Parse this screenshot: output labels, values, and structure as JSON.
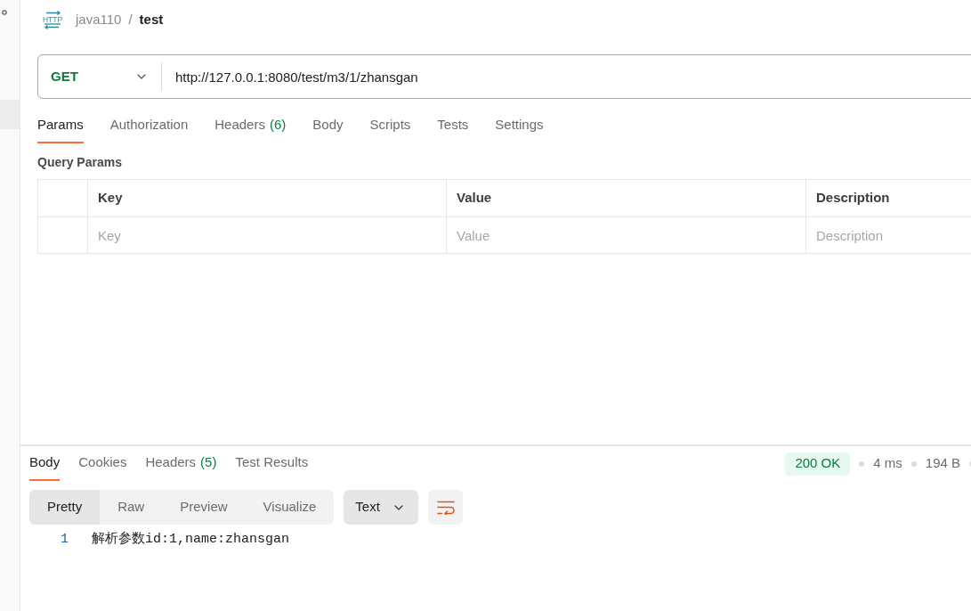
{
  "breadcrumb": {
    "icon_text": "HTTP",
    "collection": "java110",
    "separator": "/",
    "request": "test"
  },
  "request": {
    "method": "GET",
    "url": "http://127.0.0.1:8080/test/m3/1/zhansgan"
  },
  "request_tabs": [
    {
      "label": "Params",
      "selected": true
    },
    {
      "label": "Authorization",
      "selected": false
    },
    {
      "label": "Headers",
      "count": "(6)",
      "selected": false
    },
    {
      "label": "Body",
      "selected": false
    },
    {
      "label": "Scripts",
      "selected": false
    },
    {
      "label": "Tests",
      "selected": false
    },
    {
      "label": "Settings",
      "selected": false
    }
  ],
  "query_params": {
    "title": "Query Params",
    "columns": [
      "Key",
      "Value",
      "Description"
    ],
    "new_row": [
      {
        "placeholder": "Key"
      },
      {
        "placeholder": "Value"
      },
      {
        "placeholder": "Description"
      }
    ]
  },
  "response": {
    "tabs": [
      {
        "label": "Body",
        "selected": true
      },
      {
        "label": "Cookies",
        "selected": false
      },
      {
        "label": "Headers",
        "count": "(5)",
        "selected": false
      },
      {
        "label": "Test Results",
        "selected": false
      }
    ],
    "status": "200 OK",
    "time": "4 ms",
    "size": "194 B",
    "view_modes": [
      {
        "label": "Pretty",
        "selected": true
      },
      {
        "label": "Raw",
        "selected": false
      },
      {
        "label": "Preview",
        "selected": false
      },
      {
        "label": "Visualize",
        "selected": false
      }
    ],
    "format": "Text",
    "wrap_lines": true,
    "lines": [
      {
        "number": "1",
        "text": "解析参数id:1,name:zhansgan"
      }
    ]
  }
}
